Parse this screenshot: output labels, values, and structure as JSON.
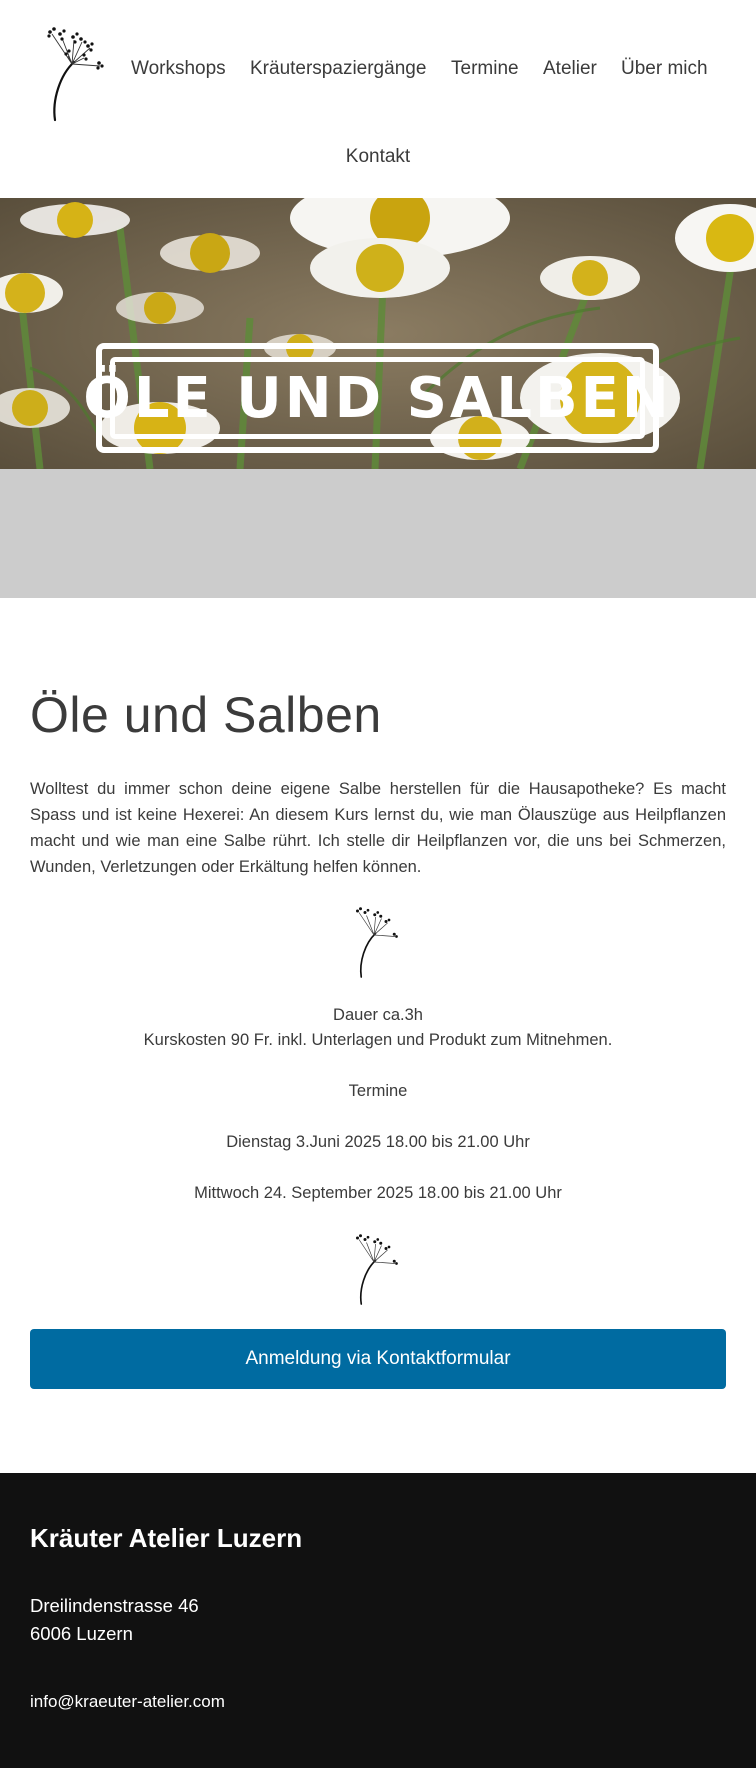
{
  "nav": {
    "items": [
      "Workshops",
      "Kräuterspaziergänge",
      "Termine",
      "Atelier",
      "Über mich",
      "Kontakt"
    ]
  },
  "hero": {
    "title": "Öle und Salben"
  },
  "main": {
    "title": "Öle und Salben",
    "intro": "Wolltest du immer schon deine eigene Salbe herstellen für die Hausapotheke? Es macht Spass und ist keine Hexerei: An diesem Kurs lernst du, wie man Ölauszüge aus Heilpflanzen macht und wie man eine Salbe rührt. Ich stelle dir Heilpflanzen vor, die uns bei Schmerzen, Wunden, Verletzungen oder Erkältung helfen können.",
    "duration": "Dauer ca.3h",
    "costs": "Kurskosten 90 Fr. inkl. Unterlagen und Produkt zum Mitnehmen.",
    "dates_heading": "Termine",
    "dates": [
      "Dienstag 3.Juni 2025 18.00 bis 21.00 Uhr",
      "Mittwoch 24. September 2025 18.00 bis 21.00 Uhr"
    ],
    "cta_label": "Anmeldung via Kontaktformular"
  },
  "footer": {
    "title": "Kräuter Atelier Luzern",
    "street": "Dreilindenstrasse 46",
    "city": "6006 Luzern",
    "email": "info@kraeuter-atelier.com"
  },
  "colors": {
    "accent": "#006ba1",
    "footer_bg": "#111111",
    "band_gray": "#cccccc"
  },
  "icons": [
    "herb-logo-icon",
    "herb-divider-icon"
  ]
}
